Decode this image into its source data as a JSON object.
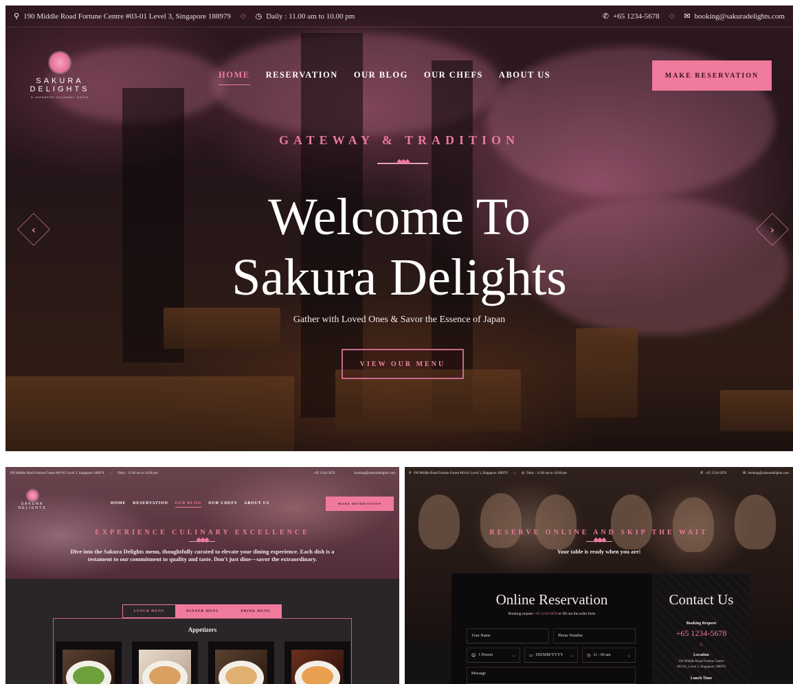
{
  "main": {
    "topbar": {
      "address": "190 Middle Road Fortune Centre #03-01 Level 3, Singapore 188979",
      "hours": "Daily : 11.00 am to 10.00 pm",
      "phone": "+65 1234-5678",
      "email": "booking@sakuradelights.com"
    },
    "logo": {
      "line1": "SAKURA",
      "line2": "DELIGHTS",
      "tagline": "A JAPANESE CULINARY OASIS"
    },
    "nav": [
      "HOME",
      "RESERVATION",
      "OUR BLOG",
      "OUR CHEFS",
      "ABOUT US"
    ],
    "cta": "MAKE RESERVATION",
    "kicker": "GATEWAY & TRADITION",
    "title_line1": "Welcome To",
    "title_line2": "Sakura Delights",
    "subtitle": "Gather with Loved Ones & Savor the Essence of Japan",
    "button": "VIEW OUR MENU",
    "prev": "‹",
    "next": "›"
  },
  "menu_page": {
    "topbar": {
      "address": "190 Middle Road Fortune Centre #03-01 Level 3, Singapore 188979",
      "hours": "Daily : 11.00 am to 10.00 pm",
      "phone": "+65 1234-5678",
      "email": "booking@sakuradelights.com"
    },
    "nav": [
      "HOME",
      "RESERVATION",
      "OUR BLOG",
      "OUR CHEFS",
      "ABOUT US"
    ],
    "cta": "MAKE RESERVATION",
    "kicker": "EXPERIENCE CULINARY EXCELLENCE",
    "desc": "Dive into the Sakura Delights menu, thoughtfully curated to elevate your dining experience. Each dish is a testament to our commitment to quality and taste. Don't just dine—savor the extraordinary.",
    "tabs": [
      "LUNCH MENU",
      "DINNER MENU",
      "DRINK MENU"
    ],
    "active_tab": "DINNER MENU",
    "section": "Appetizers"
  },
  "reservation_page": {
    "topbar": {
      "address": "190 Middle Road Fortune Centre #03-01 Level 3, Singapore 188979",
      "hours": "Daily : 11.00 am to 10.00 pm",
      "phone": "+65 1234-5678",
      "email": "booking@sakuradelights.com"
    },
    "kicker": "RESERVE ONLINE AND SKIP THE WAIT",
    "subtitle": "Your table is ready when you are!",
    "form_title": "Online Reservation",
    "booking_pre": "Booking request",
    "booking_phone": "+65 1234-5678",
    "booking_post": "or fill out the order form",
    "name_placeholder": "Your Name",
    "phone_placeholder": "Phone Number",
    "persons": "1 Person",
    "date": "DD/MM/YYYY",
    "time": "11 : 00 am",
    "message_placeholder": "Message",
    "contact_title": "Contact Us",
    "booking_label": "Booking Request",
    "contact_phone": "+65 1234-5678",
    "location_label": "Location",
    "location_line1": "190 Middle Road Fortune Centre",
    "location_line2": "#03-01, Level 3, Singapore 188979",
    "lunch_label": "Lunch Time"
  },
  "colors": {
    "accent": "#f07a9c",
    "dark": "#141214"
  }
}
